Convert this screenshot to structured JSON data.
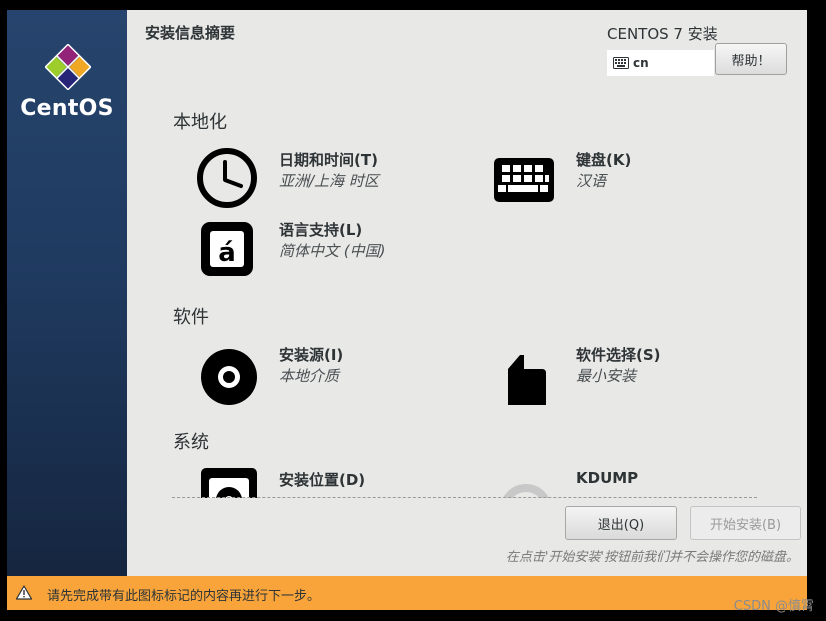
{
  "sidebar": {
    "brand": "CentOS"
  },
  "header": {
    "page_title": "安装信息摘要",
    "product_title": "CENTOS 7 安装",
    "keyboard_layout": "cn",
    "help_label": "帮助！"
  },
  "sections": {
    "localization": "本地化",
    "software": "软件",
    "system": "系统"
  },
  "spokes": {
    "datetime": {
      "title": "日期和时间(T)",
      "status": "亚洲/上海 时区",
      "icon": "clock-icon"
    },
    "keyboard": {
      "title": "键盘(K)",
      "status": "汉语",
      "icon": "keyboard-icon"
    },
    "language": {
      "title": "语言支持(L)",
      "status": "简体中文 (中国)",
      "icon": "language-icon"
    },
    "source": {
      "title": "安装源(I)",
      "status": "本地介质",
      "icon": "disc-icon"
    },
    "software": {
      "title": "软件选择(S)",
      "status": "最小安装",
      "icon": "package-icon"
    },
    "destination": {
      "title": "安装位置(D)",
      "icon": "harddisk-icon"
    },
    "kdump": {
      "title": "KDUMP",
      "icon": "kdump-icon"
    }
  },
  "footer": {
    "quit_label": "退出(Q)",
    "begin_label": "开始安装(B)",
    "note": "在点击'开始安装'按钮前我们并不会操作您的磁盘。"
  },
  "warning": {
    "text": "请先完成带有此图标标记的内容再进行下一步。"
  },
  "watermark": "CSDN @慎霄",
  "colors": {
    "sidebar": "#1f3a5f",
    "warning_bar": "#f8a43a",
    "background": "#e8e8e7"
  }
}
